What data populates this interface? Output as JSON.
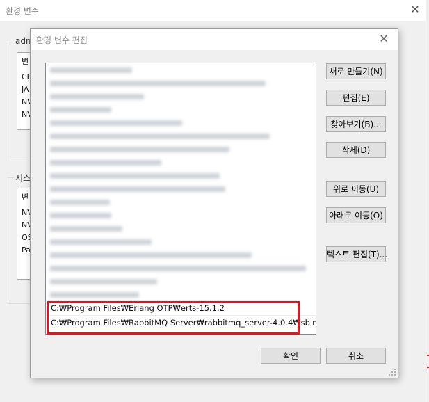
{
  "background_window": {
    "title": "환경 변수",
    "user_group_label": "adm",
    "user_list_header": "변",
    "user_list_items": [
      "CL",
      "JA",
      "NV",
      "NV"
    ],
    "system_group_label": "시스",
    "system_list_header": "변",
    "system_list_items": [
      "NV",
      "NV",
      "OS",
      "Pa"
    ],
    "close_glyph": "✕"
  },
  "dialog": {
    "title": "환경 변수 편집",
    "close_glyph": "✕",
    "paths_visible": [
      "C:₩Program Files₩Erlang OTP₩erts-15.1.2",
      "C:₩Program Files₩RabbitMQ Server₩rabbitmq_server-4.0.4₩sbin"
    ],
    "side_buttons": {
      "new": "새로 만들기(N)",
      "edit": "편집(E)",
      "browse": "찾아보기(B)...",
      "delete": "삭제(D)",
      "move_up": "위로 이동(U)",
      "move_down": "아래로 이동(O)",
      "edit_text": "텍스트 편집(T)..."
    },
    "ok": "확인",
    "cancel": "취소"
  },
  "colors": {
    "highlight": "#e8121e",
    "dialog_bg": "#f0f0f0",
    "list_bg": "#ffffff",
    "button_bg": "#e1e1e1"
  }
}
